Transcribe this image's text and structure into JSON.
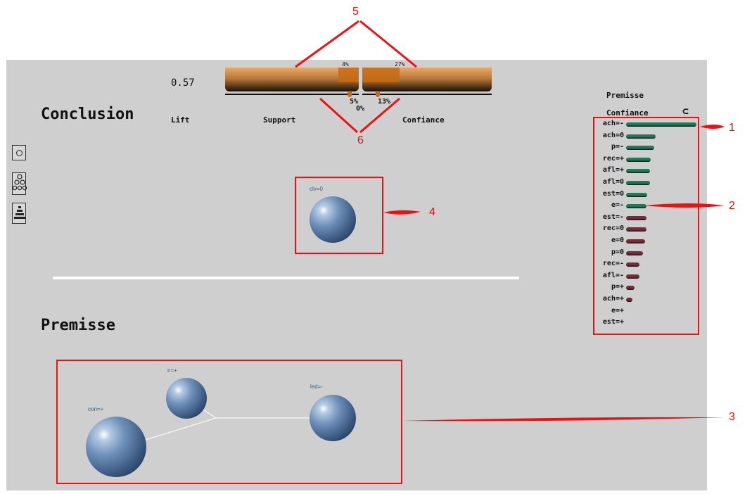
{
  "metrics": {
    "lift_value": "0.57",
    "lift_label": "Lift",
    "support_label": "Support",
    "confiance_label": "Confiance",
    "support_top_pct": "4%",
    "confiance_top_pct": "27%",
    "support_marker_pct": "5%",
    "confiance_marker_pct": "13%",
    "zero_pct": "0%",
    "support_fill": 0.04,
    "confiance_fill": 0.27
  },
  "conclusion": {
    "title": "Conclusion",
    "node_label": "clv=0"
  },
  "premisse": {
    "title": "Premisse",
    "nodes": [
      {
        "label": "con=+"
      },
      {
        "label": "n=+"
      },
      {
        "label": "led=-"
      }
    ]
  },
  "side_panel": {
    "title": "Premisse",
    "subtitle": "Confiance",
    "sort_symbol": "⊂",
    "positive_color": "#1f7a55",
    "negative_color": "#7a2b3a",
    "items": [
      {
        "label": "ach=-",
        "value": 1.0,
        "polarity": "positive"
      },
      {
        "label": "ach=0",
        "value": 0.42,
        "polarity": "positive"
      },
      {
        "label": "p=-",
        "value": 0.4,
        "polarity": "positive"
      },
      {
        "label": "rec=+",
        "value": 0.35,
        "polarity": "positive"
      },
      {
        "label": "afl=+",
        "value": 0.34,
        "polarity": "positive"
      },
      {
        "label": "afl=0",
        "value": 0.34,
        "polarity": "positive"
      },
      {
        "label": "est=0",
        "value": 0.3,
        "polarity": "positive"
      },
      {
        "label": "e=-",
        "value": 0.29,
        "polarity": "positive"
      },
      {
        "label": "est=-",
        "value": 0.29,
        "polarity": "negative"
      },
      {
        "label": "rec=0",
        "value": 0.29,
        "polarity": "negative"
      },
      {
        "label": "e=0",
        "value": 0.27,
        "polarity": "negative"
      },
      {
        "label": "p=0",
        "value": 0.24,
        "polarity": "negative"
      },
      {
        "label": "rec=-",
        "value": 0.19,
        "polarity": "negative"
      },
      {
        "label": "afl=-",
        "value": 0.19,
        "polarity": "negative"
      },
      {
        "label": "p=+",
        "value": 0.12,
        "polarity": "negative"
      },
      {
        "label": "ach=+",
        "value": 0.09,
        "polarity": "negative"
      },
      {
        "label": "e=+",
        "value": 0.0,
        "polarity": "negative"
      },
      {
        "label": "est=+",
        "value": 0.0,
        "polarity": "negative"
      }
    ]
  },
  "toolbar": {
    "single_icon": "circle-icon",
    "group_icon": "circles-group-icon",
    "stack_icon": "stack-icon"
  },
  "callouts": [
    "1",
    "2",
    "3",
    "4",
    "5",
    "6"
  ]
}
